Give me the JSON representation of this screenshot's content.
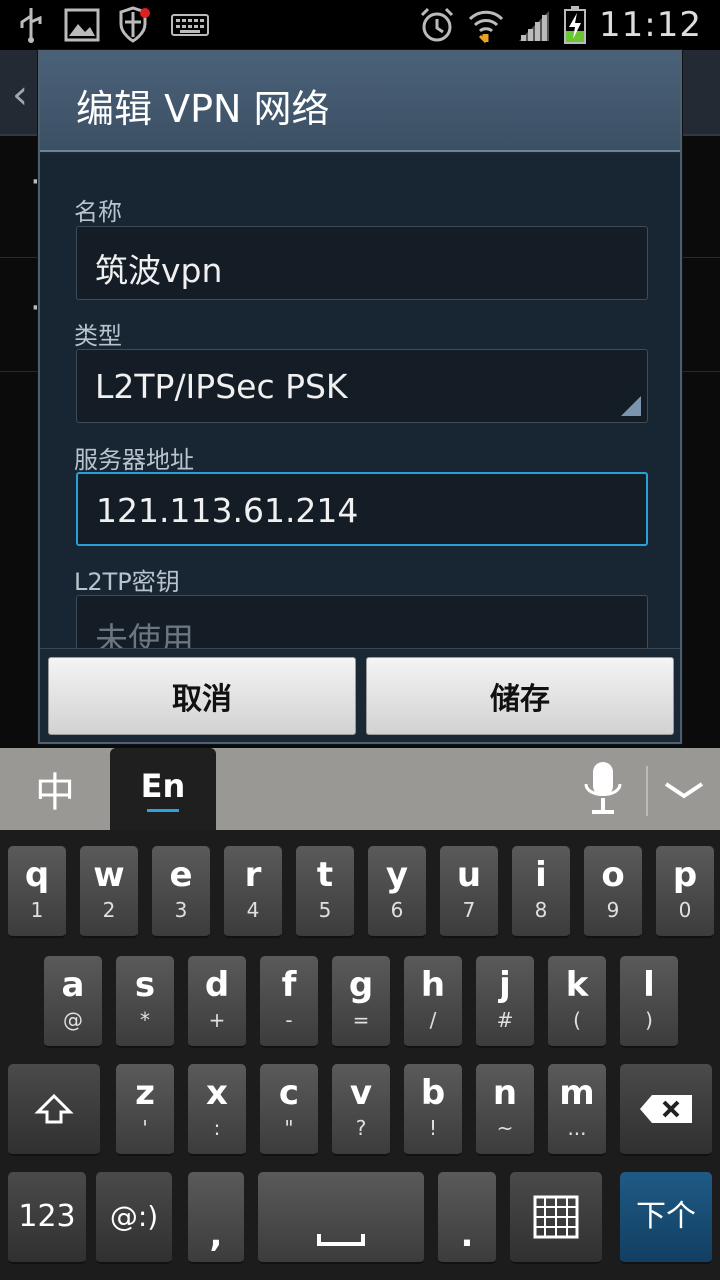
{
  "status_bar": {
    "time": "11:12",
    "left_icons": [
      "usb-icon",
      "image-icon",
      "shield-alert-icon",
      "keyboard-icon"
    ],
    "right_icons": [
      "alarm-icon",
      "wifi-icon",
      "signal-icon",
      "battery-charging-icon"
    ]
  },
  "dialog": {
    "title": "编辑 VPN 网络",
    "fields": [
      {
        "label": "名称",
        "value": "筑波vpn"
      },
      {
        "label": "类型",
        "value": "L2TP/IPSec PSK"
      },
      {
        "label": "服务器地址",
        "value": "121.113.61.214"
      },
      {
        "label": "L2TP密钥",
        "placeholder": "未使用"
      }
    ],
    "cancel_label": "取消",
    "save_label": "储存"
  },
  "keyboard": {
    "lang_chinese": "中",
    "lang_english": "En",
    "row1": [
      {
        "main": "q",
        "sub": "1"
      },
      {
        "main": "w",
        "sub": "2"
      },
      {
        "main": "e",
        "sub": "3"
      },
      {
        "main": "r",
        "sub": "4"
      },
      {
        "main": "t",
        "sub": "5"
      },
      {
        "main": "y",
        "sub": "6"
      },
      {
        "main": "u",
        "sub": "7"
      },
      {
        "main": "i",
        "sub": "8"
      },
      {
        "main": "o",
        "sub": "9"
      },
      {
        "main": "p",
        "sub": "0"
      }
    ],
    "row2": [
      {
        "main": "a",
        "sub": "@"
      },
      {
        "main": "s",
        "sub": "*"
      },
      {
        "main": "d",
        "sub": "+"
      },
      {
        "main": "f",
        "sub": "-"
      },
      {
        "main": "g",
        "sub": "="
      },
      {
        "main": "h",
        "sub": "/"
      },
      {
        "main": "j",
        "sub": "#"
      },
      {
        "main": "k",
        "sub": "("
      },
      {
        "main": "l",
        "sub": ")"
      }
    ],
    "row3": [
      {
        "main": "z",
        "sub": "'"
      },
      {
        "main": "x",
        "sub": ":"
      },
      {
        "main": "c",
        "sub": "\""
      },
      {
        "main": "v",
        "sub": "?"
      },
      {
        "main": "b",
        "sub": "!"
      },
      {
        "main": "n",
        "sub": "~"
      },
      {
        "main": "m",
        "sub": "..."
      }
    ],
    "key_123": "123",
    "key_emoticon": "@:)",
    "key_comma": ",",
    "key_period": ".",
    "key_enter": "下个",
    "accent_color": "#2aa3e0"
  }
}
